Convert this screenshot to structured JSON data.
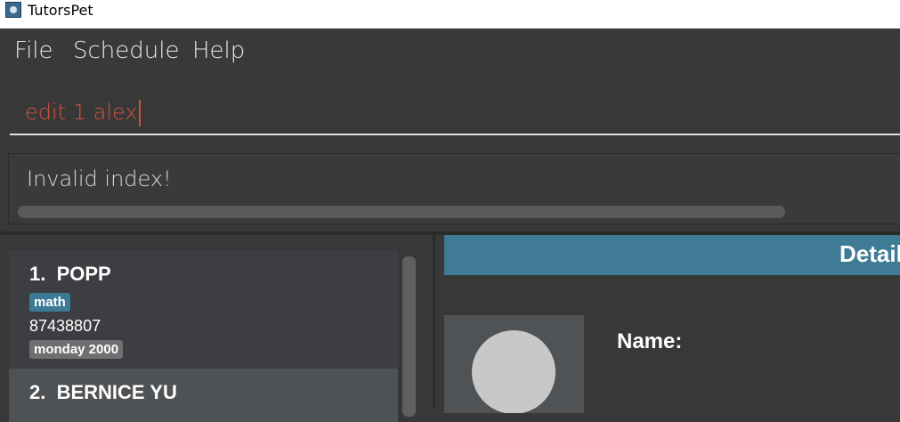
{
  "window": {
    "title": "TutorsPet",
    "icon": "paw-icon"
  },
  "menu": {
    "items": [
      "File",
      "Schedule",
      "Help"
    ]
  },
  "command": {
    "value": "edit 1 alex"
  },
  "result": {
    "message": "Invalid index!"
  },
  "students": [
    {
      "title": "1.  POPP",
      "subject": "math",
      "phone": "87438807",
      "slot": "monday 2000"
    },
    {
      "title": "2.  BERNICE YU"
    }
  ],
  "details": {
    "header": "Detail",
    "name_label": "Name:"
  },
  "colors": {
    "accent": "#3f7b95",
    "command_text": "#d0533e",
    "background": "#383838"
  }
}
